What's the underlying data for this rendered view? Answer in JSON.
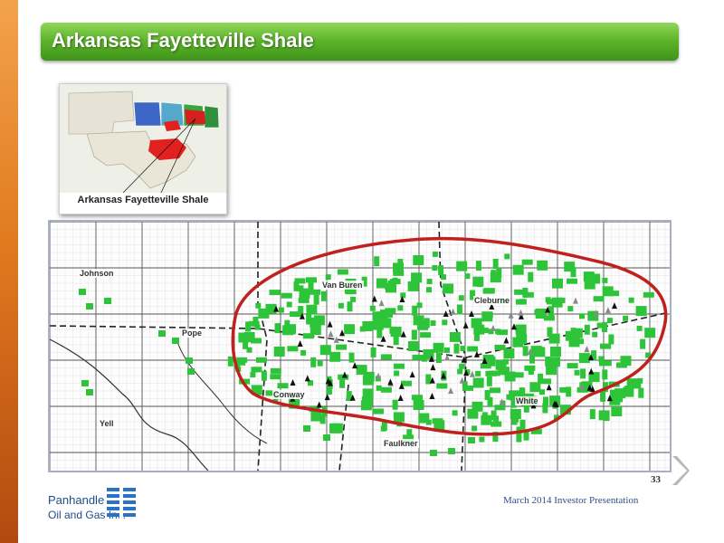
{
  "slide": {
    "title": "Arkansas Fayetteville Shale",
    "page_number": "33",
    "footer": "March 2014 Investor Presentation"
  },
  "inset": {
    "caption": "Arkansas Fayetteville Shale"
  },
  "map": {
    "counties": [
      "Johnson",
      "Van Buren",
      "Cleburne",
      "Pope",
      "Conway",
      "White",
      "Yell",
      "Faulkner"
    ]
  },
  "logo": {
    "line1": "Panhandle",
    "line2": "Oil and Gas Inc."
  },
  "colors": {
    "title_green": "#5fb62c",
    "accent_orange": "#e07a1f",
    "acreage_green": "#2ec43a",
    "play_outline_red": "#c0201e",
    "footer_blue": "#2f4f86"
  },
  "icons": [
    "next-slide-chevron-icon",
    "well-rig-icon",
    "panhandle-logo-icon"
  ]
}
